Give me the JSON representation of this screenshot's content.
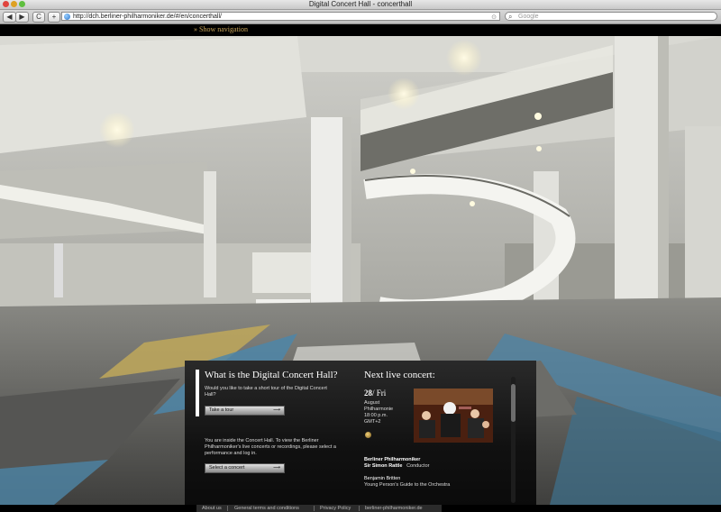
{
  "browser": {
    "window_title": "Digital Concert Hall - concerthall",
    "url": "http://dch.berliner-philharmoniker.de/#/en/concerthall/",
    "search_placeholder": "Google",
    "back_glyph": "◀",
    "forward_glyph": "▶",
    "reload_glyph": "C",
    "add_glyph": "+",
    "rss_glyph": "⊙",
    "search_glyph": "⌕"
  },
  "site": {
    "show_navigation": "» Show navigation"
  },
  "panel": {
    "left_title": "What is the Digital Concert Hall?",
    "tour_question": "Would you like to take a short tour of the Digital Concert Hall?",
    "tour_button": "Take a tour",
    "inside_text": "You are inside the Concert Hall. To view the Berliner Philharmoniker's live concerts or recordings, please select a performance and log in.",
    "select_button": "Select a concert",
    "button_arrow": "⟶",
    "right_title": "Next live concert:",
    "concert": {
      "day": "28",
      "weekday": "/ Fri",
      "month": "August",
      "venue": "Philharmonie",
      "time": "18:00 p.m.",
      "timezone": "GMT+2",
      "orchestra": "Berliner Philharmoniker",
      "conductor_name": "Sir Simon Rattle",
      "conductor_role": "Conductor",
      "work_composer": "Benjamin Britten",
      "work_title": "Young Person's Guide to the Orchestra"
    }
  },
  "footer": {
    "links": [
      "About us",
      "General terms and conditions",
      "Privacy Policy",
      "berliner-philharmoniker.de"
    ]
  },
  "colors": {
    "accent": "#c9a55a",
    "panel_bg": "#111111",
    "floor_blue": "#4d86a8",
    "floor_yellow": "#bfa85a"
  }
}
